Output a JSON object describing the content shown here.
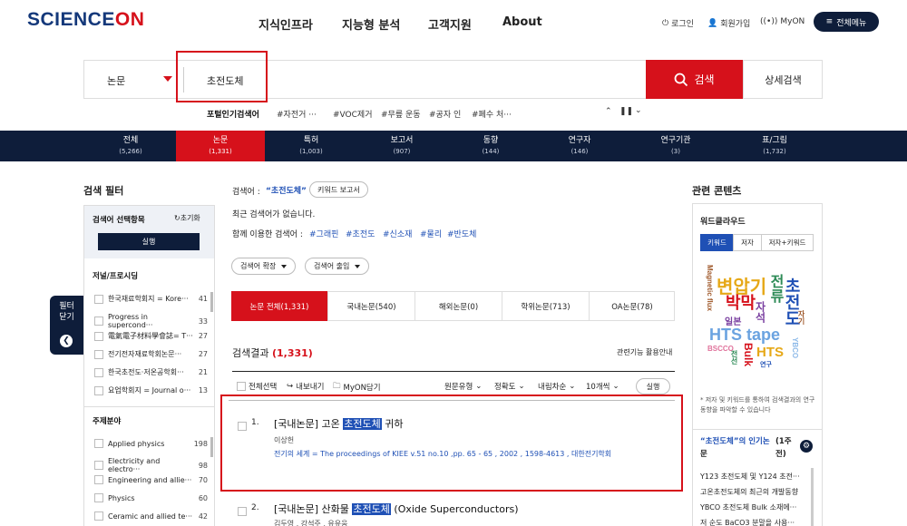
{
  "header": {
    "logo_a": "SCIENCE",
    "logo_b": "ON",
    "nav": [
      "지식인프라",
      "지능형 분석",
      "고객지원",
      "About"
    ],
    "login": "로그인",
    "signup": "회원가입",
    "myon": "MyON",
    "menu": "전체메뉴"
  },
  "search": {
    "select": "논문",
    "query": "초전도체",
    "button": "검색",
    "detail": "상세검색",
    "popular_label": "포털인기검색어",
    "popular": [
      "#자전거 ···",
      "#VOC제거",
      "#무릎 운동",
      "#공자 인",
      "#폐수 처···"
    ]
  },
  "tabs": [
    {
      "label": "전체",
      "count": "(5,266)"
    },
    {
      "label": "논문",
      "count": "(1,331)"
    },
    {
      "label": "특허",
      "count": "(1,003)"
    },
    {
      "label": "보고서",
      "count": "(907)"
    },
    {
      "label": "동향",
      "count": "(144)"
    },
    {
      "label": "연구자",
      "count": "(146)"
    },
    {
      "label": "연구기관",
      "count": "(3)"
    },
    {
      "label": "표/그림",
      "count": "(1,732)"
    }
  ],
  "filter": {
    "title": "검색 필터",
    "sel_label": "검색어 선택항목",
    "reset": "초기화",
    "run": "실행",
    "close_a": "필터",
    "close_b": "닫기",
    "sec1": "저널/프로시딩",
    "journals": [
      {
        "name": "한국재료학회지 = Kore···",
        "count": "41"
      },
      {
        "name": "Progress in supercond···",
        "count": "33"
      },
      {
        "name": "電氣電子材料學會誌= T···",
        "count": "27"
      },
      {
        "name": "전기전자재료학회논문···",
        "count": "27"
      },
      {
        "name": "한국초전도·저온공학회···",
        "count": "21"
      },
      {
        "name": "요업학회지 = Journal o···",
        "count": "13"
      }
    ],
    "sec2": "주제분야",
    "subjects": [
      {
        "name": "Applied physics",
        "count": "198"
      },
      {
        "name": "Electricity and electro···",
        "count": "98"
      },
      {
        "name": "Engineering and allie···",
        "count": "70"
      },
      {
        "name": "Physics",
        "count": "60"
      },
      {
        "name": "Ceramic and allied te···",
        "count": "42"
      }
    ]
  },
  "main": {
    "kw_label": "검색어 :",
    "kw": "“초전도체”",
    "kw_report": "키워드 보고서",
    "recent": "최근 검색어가 없습니다.",
    "assoc_label": "함께 이용한 검색어 :",
    "assoc": [
      "#그래핀",
      "#초전도",
      "#신소재",
      "#물리",
      "#반도체"
    ],
    "expand": "검색어 확장",
    "exclude": "검색어 출입",
    "result_tabs": [
      "논문 전체(1,331)",
      "국내논문(540)",
      "해외논문(0)",
      "학위논문(713)",
      "OA논문(78)"
    ],
    "results_label": "검색결과",
    "results_count": "(1,331)",
    "guide": "관련기능 활용안내",
    "tools": [
      "전체선택",
      "내보내기",
      "MyON담기"
    ],
    "sorts": [
      "원문유형",
      "정확도",
      "내림차순",
      "10개씩"
    ],
    "run": "실행",
    "items": [
      {
        "num": "1.",
        "pre": "[국내논문] 고온 ",
        "hl": "초전도체",
        "post": " 귀하",
        "author": "이상헌",
        "source": "전기의 세계 = The proceedings of KIEE v.51 no.10 ,pp. 65 - 65 , 2002 , 1598-4613 , 대한전기학회"
      },
      {
        "num": "2.",
        "pre": "[국내논문] 산화물 ",
        "hl": "초전도체",
        "post": " (Oxide Superconductors)",
        "author": "김두영 , 강석주 , 유유웅"
      }
    ]
  },
  "right": {
    "title": "관련 콘텐츠",
    "wc_title": "워드클라우드",
    "wc_tabs": [
      "키워드",
      "저자",
      "저자+키워드"
    ],
    "words": [
      "변압기",
      "박막",
      "전류",
      "초전도",
      "자석",
      "Magnetic flux",
      "HTS tape",
      "일본",
      "HTS",
      "Bulk",
      "BSCCO",
      "YBCO",
      "전선",
      "자기",
      "연구"
    ],
    "wc_note": "* 저자 및 키워드를 통하여 검색결과의 연구동향을 파악할 수 있습니다",
    "pop_title_a": "“초전도체”의 인기논",
    "pop_title_b": "문",
    "pop_period": "(1주",
    "pop_period_b": "전)",
    "pop_list": [
      "Y123 초전도체 및 Y124 초전···",
      "고온초전도체의 최근의 개발동향",
      "YBCO 초전도체 Bulk 소재에···",
      "저 순도 BaCO3 분말을 사용···"
    ]
  },
  "colors": {
    "accent": "#d6111b",
    "navy": "#0e1d3a",
    "link": "#1f50b5"
  }
}
